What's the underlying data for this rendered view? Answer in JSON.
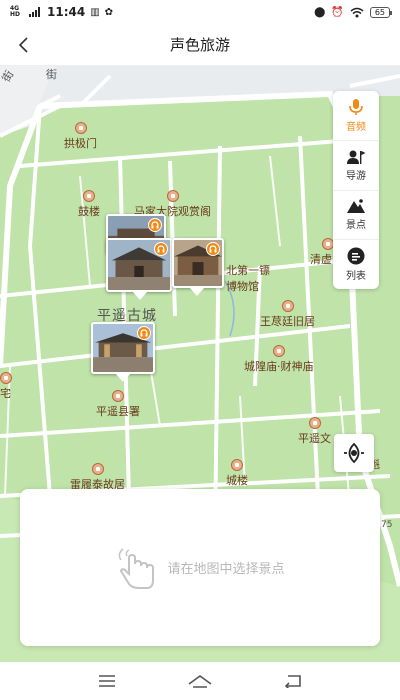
{
  "status_bar": {
    "network": "4G HD",
    "time": "11:44",
    "battery": "65"
  },
  "header": {
    "title": "声色旅游"
  },
  "map": {
    "streets": [
      "街",
      "街"
    ],
    "area_name": "平遥古城",
    "pois": [
      {
        "name": "拱极门"
      },
      {
        "name": "鼓楼"
      },
      {
        "name": "马家大院观赏阁"
      },
      {
        "name": "清虚"
      },
      {
        "name": "北第一镖"
      },
      {
        "name": "博物馆"
      },
      {
        "name": "王荩廷旧居"
      },
      {
        "name": "城隍庙·财神庙"
      },
      {
        "name": "宅"
      },
      {
        "name": "平遥县署"
      },
      {
        "name": "平遥文"
      },
      {
        "name": "魁"
      },
      {
        "name": "雷履泰故居"
      },
      {
        "name": "城楼"
      },
      {
        "name": "75"
      }
    ],
    "pins": [
      {
        "name": "scenic-pin-1",
        "audio": true
      },
      {
        "name": "scenic-pin-2",
        "audio": true
      },
      {
        "name": "scenic-pin-3",
        "audio": true
      },
      {
        "name": "scenic-pin-4",
        "audio": true
      }
    ]
  },
  "toolbar": {
    "items": [
      {
        "label": "音频",
        "icon": "microphone-icon",
        "active": true
      },
      {
        "label": "导游",
        "icon": "guide-icon",
        "active": false
      },
      {
        "label": "景点",
        "icon": "mountain-icon",
        "active": false
      },
      {
        "label": "列表",
        "icon": "list-icon",
        "active": false
      }
    ]
  },
  "locate_button": {
    "icon": "locate-icon"
  },
  "info_card": {
    "hint": "请在地图中选择景点",
    "icon": "tap-hand-icon"
  },
  "nav_bar": {
    "icons": [
      "menu-icon",
      "home-icon",
      "back-icon"
    ]
  },
  "colors": {
    "accent": "#ef8a17",
    "map_green": "#bfe3a8",
    "road": "#ffffff",
    "poi": "#b46a3c"
  }
}
